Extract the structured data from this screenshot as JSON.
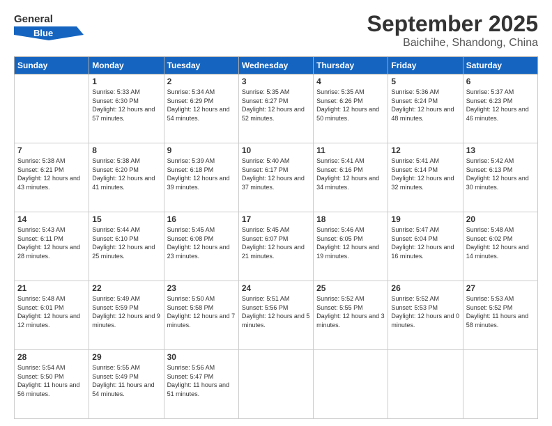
{
  "header": {
    "logo_line1": "General",
    "logo_line2": "Blue",
    "month": "September 2025",
    "location": "Baichihe, Shandong, China"
  },
  "days": [
    "Sunday",
    "Monday",
    "Tuesday",
    "Wednesday",
    "Thursday",
    "Friday",
    "Saturday"
  ],
  "weeks": [
    [
      {
        "num": "",
        "empty": true
      },
      {
        "num": "1",
        "sunrise": "Sunrise: 5:33 AM",
        "sunset": "Sunset: 6:30 PM",
        "daylight": "Daylight: 12 hours and 57 minutes."
      },
      {
        "num": "2",
        "sunrise": "Sunrise: 5:34 AM",
        "sunset": "Sunset: 6:29 PM",
        "daylight": "Daylight: 12 hours and 54 minutes."
      },
      {
        "num": "3",
        "sunrise": "Sunrise: 5:35 AM",
        "sunset": "Sunset: 6:27 PM",
        "daylight": "Daylight: 12 hours and 52 minutes."
      },
      {
        "num": "4",
        "sunrise": "Sunrise: 5:35 AM",
        "sunset": "Sunset: 6:26 PM",
        "daylight": "Daylight: 12 hours and 50 minutes."
      },
      {
        "num": "5",
        "sunrise": "Sunrise: 5:36 AM",
        "sunset": "Sunset: 6:24 PM",
        "daylight": "Daylight: 12 hours and 48 minutes."
      },
      {
        "num": "6",
        "sunrise": "Sunrise: 5:37 AM",
        "sunset": "Sunset: 6:23 PM",
        "daylight": "Daylight: 12 hours and 46 minutes."
      }
    ],
    [
      {
        "num": "7",
        "sunrise": "Sunrise: 5:38 AM",
        "sunset": "Sunset: 6:21 PM",
        "daylight": "Daylight: 12 hours and 43 minutes."
      },
      {
        "num": "8",
        "sunrise": "Sunrise: 5:38 AM",
        "sunset": "Sunset: 6:20 PM",
        "daylight": "Daylight: 12 hours and 41 minutes."
      },
      {
        "num": "9",
        "sunrise": "Sunrise: 5:39 AM",
        "sunset": "Sunset: 6:18 PM",
        "daylight": "Daylight: 12 hours and 39 minutes."
      },
      {
        "num": "10",
        "sunrise": "Sunrise: 5:40 AM",
        "sunset": "Sunset: 6:17 PM",
        "daylight": "Daylight: 12 hours and 37 minutes."
      },
      {
        "num": "11",
        "sunrise": "Sunrise: 5:41 AM",
        "sunset": "Sunset: 6:16 PM",
        "daylight": "Daylight: 12 hours and 34 minutes."
      },
      {
        "num": "12",
        "sunrise": "Sunrise: 5:41 AM",
        "sunset": "Sunset: 6:14 PM",
        "daylight": "Daylight: 12 hours and 32 minutes."
      },
      {
        "num": "13",
        "sunrise": "Sunrise: 5:42 AM",
        "sunset": "Sunset: 6:13 PM",
        "daylight": "Daylight: 12 hours and 30 minutes."
      }
    ],
    [
      {
        "num": "14",
        "sunrise": "Sunrise: 5:43 AM",
        "sunset": "Sunset: 6:11 PM",
        "daylight": "Daylight: 12 hours and 28 minutes."
      },
      {
        "num": "15",
        "sunrise": "Sunrise: 5:44 AM",
        "sunset": "Sunset: 6:10 PM",
        "daylight": "Daylight: 12 hours and 25 minutes."
      },
      {
        "num": "16",
        "sunrise": "Sunrise: 5:45 AM",
        "sunset": "Sunset: 6:08 PM",
        "daylight": "Daylight: 12 hours and 23 minutes."
      },
      {
        "num": "17",
        "sunrise": "Sunrise: 5:45 AM",
        "sunset": "Sunset: 6:07 PM",
        "daylight": "Daylight: 12 hours and 21 minutes."
      },
      {
        "num": "18",
        "sunrise": "Sunrise: 5:46 AM",
        "sunset": "Sunset: 6:05 PM",
        "daylight": "Daylight: 12 hours and 19 minutes."
      },
      {
        "num": "19",
        "sunrise": "Sunrise: 5:47 AM",
        "sunset": "Sunset: 6:04 PM",
        "daylight": "Daylight: 12 hours and 16 minutes."
      },
      {
        "num": "20",
        "sunrise": "Sunrise: 5:48 AM",
        "sunset": "Sunset: 6:02 PM",
        "daylight": "Daylight: 12 hours and 14 minutes."
      }
    ],
    [
      {
        "num": "21",
        "sunrise": "Sunrise: 5:48 AM",
        "sunset": "Sunset: 6:01 PM",
        "daylight": "Daylight: 12 hours and 12 minutes."
      },
      {
        "num": "22",
        "sunrise": "Sunrise: 5:49 AM",
        "sunset": "Sunset: 5:59 PM",
        "daylight": "Daylight: 12 hours and 9 minutes."
      },
      {
        "num": "23",
        "sunrise": "Sunrise: 5:50 AM",
        "sunset": "Sunset: 5:58 PM",
        "daylight": "Daylight: 12 hours and 7 minutes."
      },
      {
        "num": "24",
        "sunrise": "Sunrise: 5:51 AM",
        "sunset": "Sunset: 5:56 PM",
        "daylight": "Daylight: 12 hours and 5 minutes."
      },
      {
        "num": "25",
        "sunrise": "Sunrise: 5:52 AM",
        "sunset": "Sunset: 5:55 PM",
        "daylight": "Daylight: 12 hours and 3 minutes."
      },
      {
        "num": "26",
        "sunrise": "Sunrise: 5:52 AM",
        "sunset": "Sunset: 5:53 PM",
        "daylight": "Daylight: 12 hours and 0 minutes."
      },
      {
        "num": "27",
        "sunrise": "Sunrise: 5:53 AM",
        "sunset": "Sunset: 5:52 PM",
        "daylight": "Daylight: 11 hours and 58 minutes."
      }
    ],
    [
      {
        "num": "28",
        "sunrise": "Sunrise: 5:54 AM",
        "sunset": "Sunset: 5:50 PM",
        "daylight": "Daylight: 11 hours and 56 minutes."
      },
      {
        "num": "29",
        "sunrise": "Sunrise: 5:55 AM",
        "sunset": "Sunset: 5:49 PM",
        "daylight": "Daylight: 11 hours and 54 minutes."
      },
      {
        "num": "30",
        "sunrise": "Sunrise: 5:56 AM",
        "sunset": "Sunset: 5:47 PM",
        "daylight": "Daylight: 11 hours and 51 minutes."
      },
      {
        "num": "",
        "empty": true
      },
      {
        "num": "",
        "empty": true
      },
      {
        "num": "",
        "empty": true
      },
      {
        "num": "",
        "empty": true
      }
    ]
  ]
}
